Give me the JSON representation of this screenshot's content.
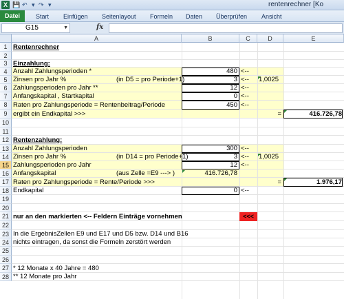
{
  "window": {
    "app_icon": "X",
    "title": "rentenrechner [Ko"
  },
  "ribbon": {
    "tabs": [
      "Datei",
      "Start",
      "Einfügen",
      "Seitenlayout",
      "Formeln",
      "Daten",
      "Überprüfen",
      "Ansicht"
    ]
  },
  "formula_bar": {
    "name_box": "G15",
    "fx": "fx",
    "value": ""
  },
  "columns": [
    "A",
    "B",
    "C",
    "D",
    "E"
  ],
  "rows": [
    "1",
    "2",
    "3",
    "4",
    "5",
    "6",
    "7",
    "8",
    "9",
    "10",
    "11",
    "12",
    "13",
    "14",
    "15",
    "16",
    "17",
    "18",
    "19",
    "20",
    "21",
    "22",
    "23",
    "24",
    "25",
    "26",
    "27",
    "28"
  ],
  "cells": {
    "a1": "Rentenrechner",
    "a3": "Einzahlung:",
    "a4": "Anzahl Zahlungsperioden *",
    "b4": "480",
    "c4": "<--",
    "a5": "Zinsen pro Jahr    %",
    "a5b": "(in D5 = pro Periode+1)",
    "b5": "3",
    "c5": "<--",
    "d5": "1,0025",
    "a6": "Zahlungsperioden pro Jahr **",
    "b6": "12",
    "c6": "<--",
    "a7": "Anfangskapital , Startkapital",
    "b7": "0",
    "c7": "<--",
    "a8": "Raten pro Zahlungsperiode = Rentenbeitrag/Periode",
    "b8": "450",
    "c8": "<--",
    "a9": "ergibt ein Endkapital >>>",
    "d9": "=",
    "e9": "416.726,78",
    "a12": "Rentenzahlung:",
    "a13": "Anzahl Zahlungsperioden",
    "b13": "300",
    "c13": "<--",
    "a14": "Zinsen pro Jahr    %",
    "a14b": "(in D14 = pro Periode+1)",
    "b14": "3",
    "c14": "<--",
    "d14": "1,0025",
    "a15": "Zahlungsperioden pro Jahr",
    "b15": "12",
    "c15": "<--",
    "a16": "Anfangskapital",
    "a16b": "(aus Zelle =E9 ---> )",
    "b16": "416.726,78",
    "a17": "Raten pro Zahlungsperiode = Rente/Periode >>>",
    "d17": "=",
    "e17": "1.976,17",
    "a18": "Endkapital",
    "b18": "0",
    "c18": "<--",
    "a21": "nur an den markierten <-- Feldern Einträge vornehmen",
    "c21": "<<<",
    "a23": "In die ErgebnisZellen E9 und E17 und D5 bzw. D14 und B16",
    "a24": "nichts eintragen, da sonst die Formeln zerstört werden",
    "a27": "*    12 Monate x 40 Jahre = 480",
    "a28": "**   12 Monate pro Jahr"
  },
  "colors": {
    "input_fill": "#ffffcc",
    "warning_fill": "#ee2222",
    "file_tab": "#2a8a3e",
    "selected_row_header": "#f7d58c"
  }
}
